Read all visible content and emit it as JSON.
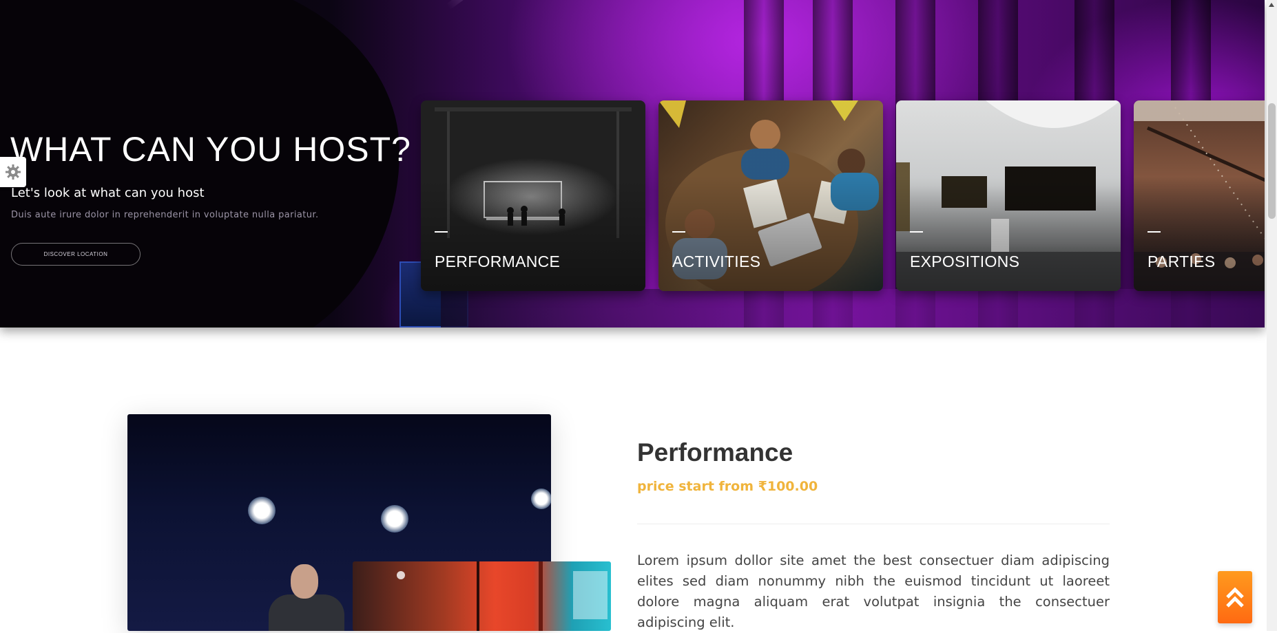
{
  "hero": {
    "title": "WHAT CAN YOU HOST?",
    "subtitle": "Let's look at what can you host",
    "description": "Duis aute irure dolor in reprehenderit in voluptate nulla pariatur.",
    "cta_label": "DISCOVER LOCATION"
  },
  "settings": {
    "icon": "gear-icon"
  },
  "cards": [
    {
      "label": "PERFORMANCE"
    },
    {
      "label": "ACTIVITIES"
    },
    {
      "label": "EXPOSITIONS"
    },
    {
      "label": "PARTIES"
    }
  ],
  "detail": {
    "title": "Performance",
    "price": "price start from ₹100.00",
    "text": "Lorem ipsum dollor site amet the best consectuer diam adipiscing elites sed diam nonummy nibh the euismod tincidunt ut laoreet dolore magna aliquam erat volutpat insignia the consectuer adipiscing elit."
  },
  "back_to_top": {
    "icon": "double-chevron-up-icon"
  },
  "colors": {
    "accent_price": "#f0b43c",
    "back_to_top": "#ff7a14",
    "hero_purple": "#7a14a3"
  }
}
